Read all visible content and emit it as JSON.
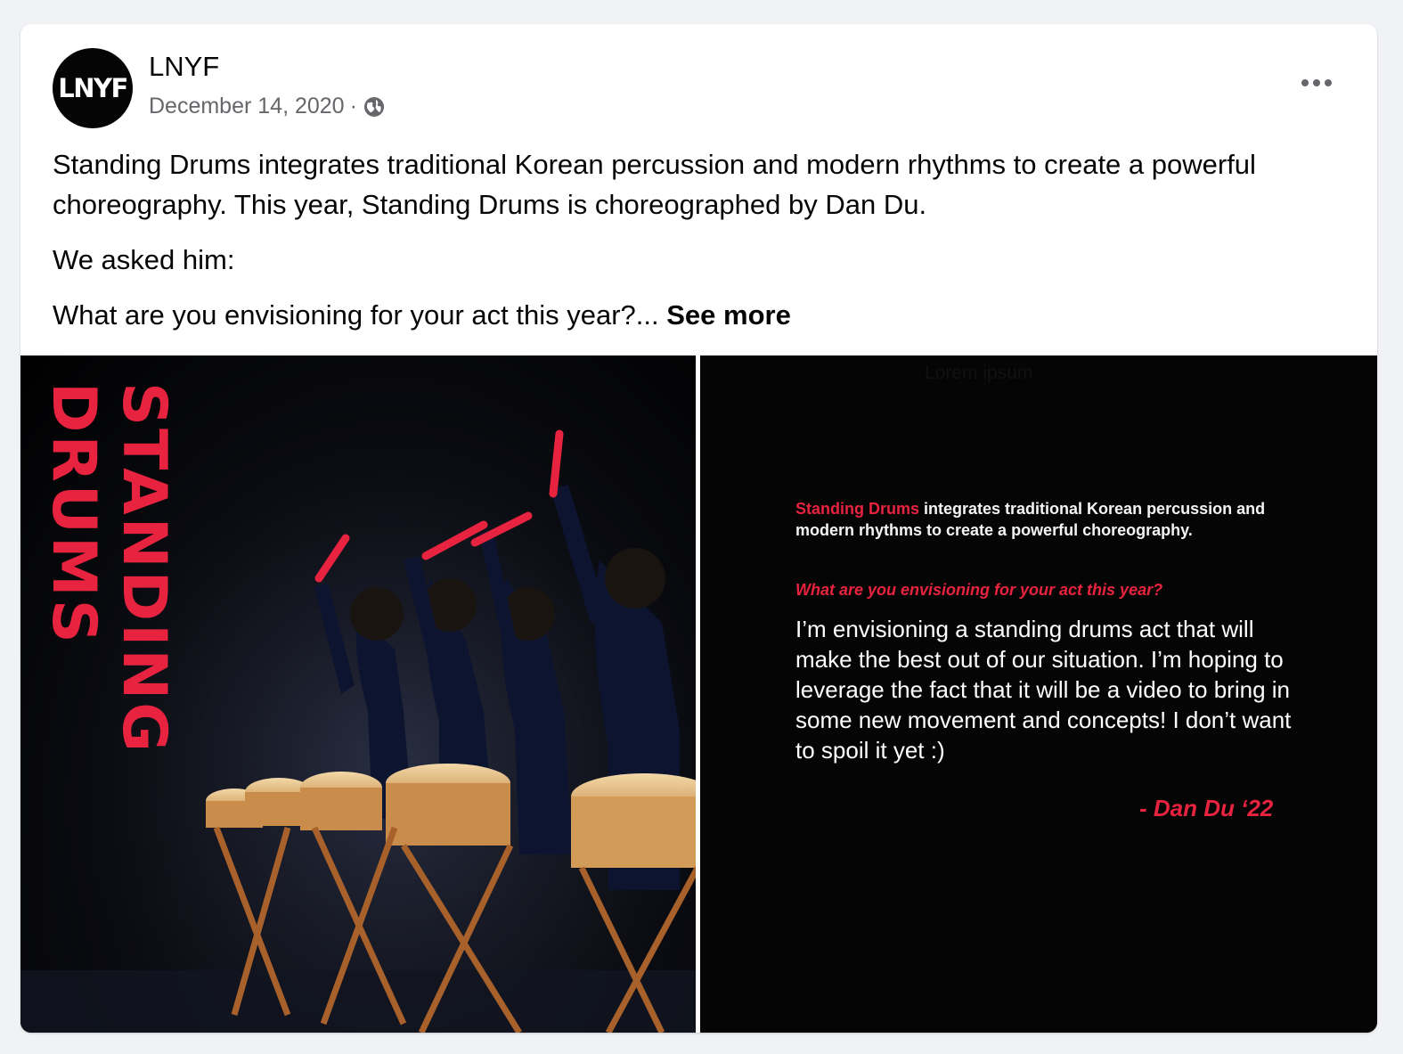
{
  "post": {
    "author": "LNYF",
    "avatar_text": "LNYF",
    "date": "December 14, 2020",
    "separator": "·",
    "audience_icon": "globe-icon",
    "more_icon": "more-options-icon",
    "paragraphs": [
      "Standing Drums integrates traditional Korean percussion and modern rhythms to create a powerful choreography. This year, Standing Drums is choreographed by Dan Du.",
      "We asked him:"
    ],
    "teaser": "What are you envisioning for your act this year?...",
    "see_more": "See more"
  },
  "images": {
    "left": {
      "vertical_title": "STANDING DRUMS"
    },
    "right": {
      "lorem": "Lorem ipsum",
      "intro_highlight": "Standing Drums",
      "intro_rest": " integrates traditional Korean percussion and modern rhythms to create a powerful choreography.",
      "question": "What are you envisioning for your act this year?",
      "answer": "I’m envisioning a standing drums act that will make the best out of our situation. I’m hoping to leverage the fact that it will be a video to bring in some new movement and concepts! I don’t want to spoil it yet :)",
      "signature": "- Dan Du ‘22"
    }
  },
  "colors": {
    "accent": "#e8233f",
    "background": "#f0f2f5",
    "card": "#ffffff"
  }
}
